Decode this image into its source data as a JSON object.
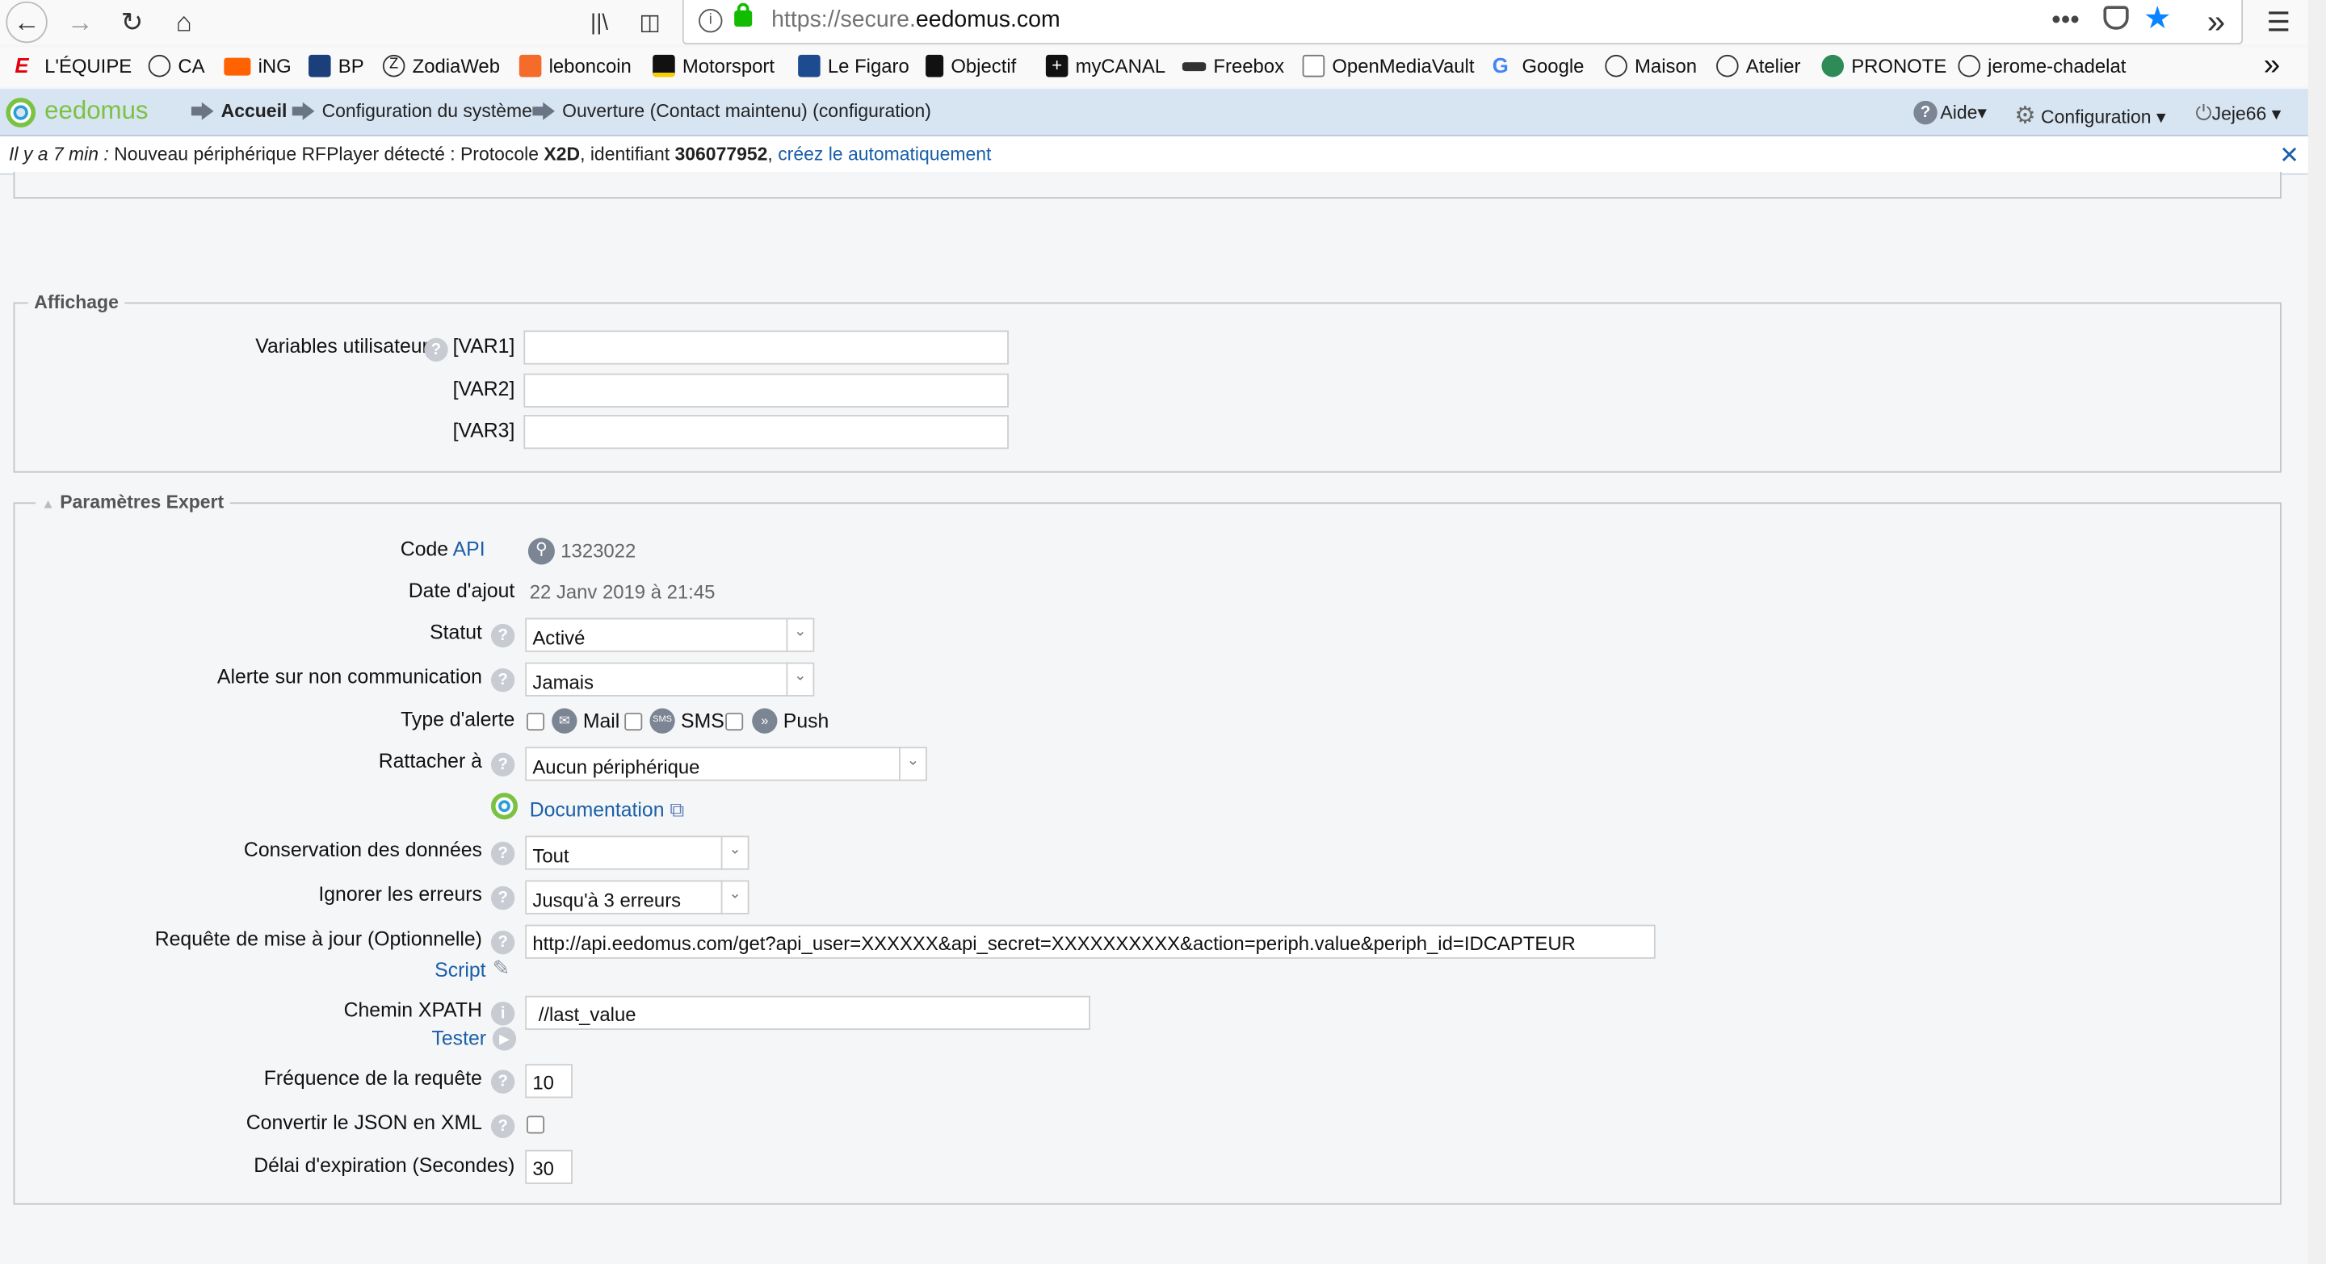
{
  "browser": {
    "url_prefix": "https://secure.",
    "url_domain": "eedomus.com",
    "bookmarks": [
      "L'ÉQUIPE",
      "CA",
      "iNG",
      "BP",
      "ZodiaWeb",
      "leboncoin",
      "Motorsport",
      "Le Figaro",
      "Objectif",
      "myCANAL",
      "Freebox",
      "OpenMediaVault",
      "Google",
      "Maison",
      "Atelier",
      "PRONOTE",
      "jerome-chadelat"
    ]
  },
  "app": {
    "logo": "eedomus",
    "breadcrumb": [
      "Accueil",
      "Configuration du système",
      "Ouverture (Contact maintenu) (configuration)"
    ],
    "menu": {
      "help": "Aide",
      "config": "Configuration",
      "user": "Jeje66"
    }
  },
  "notification": {
    "time": "Il y a 7 min :",
    "text1": " Nouveau périphérique RFPlayer détecté : Protocole ",
    "protocol": "X2D",
    "text2": ", identifiant ",
    "identifier": "306077952",
    "text3": ", ",
    "link": "créez le automatiquement"
  },
  "affichage": {
    "legend": "Affichage",
    "user_vars_label": "Variables utilisateur",
    "vars": [
      "[VAR1]",
      "[VAR2]",
      "[VAR3]"
    ]
  },
  "expert": {
    "legend": "Paramètres Expert",
    "code_label": "Code",
    "code_api": "API",
    "code_value": "1323022",
    "date_label": "Date d'ajout",
    "date_value": "22 Janv 2019 à 21:45",
    "statut_label": "Statut",
    "statut_value": "Activé",
    "alerte_label": "Alerte sur non communication",
    "alerte_value": "Jamais",
    "type_label": "Type d'alerte",
    "types": [
      "Mail",
      "SMS",
      "Push"
    ],
    "rattacher_label": "Rattacher à",
    "rattacher_value": "Aucun périphérique",
    "documentation": "Documentation",
    "conservation_label": "Conservation des données",
    "conservation_value": "Tout",
    "ignorer_label": "Ignorer les erreurs",
    "ignorer_value": "Jusqu'à 3 erreurs",
    "requete_label": "Requête de mise à jour (Optionnelle)",
    "requete_value": "http://api.eedomus.com/get?api_user=XXXXXX&api_secret=XXXXXXXXXX&action=periph.value&periph_id=IDCAPTEUR",
    "script_link": "Script",
    "xpath_label": "Chemin XPATH",
    "xpath_value": "//last_value",
    "tester_link": "Tester",
    "freq_label": "Fréquence de la requête",
    "freq_value": "10",
    "json_label": "Convertir le JSON en XML",
    "delai_label": "Délai d'expiration (Secondes)",
    "delai_value": "30"
  }
}
